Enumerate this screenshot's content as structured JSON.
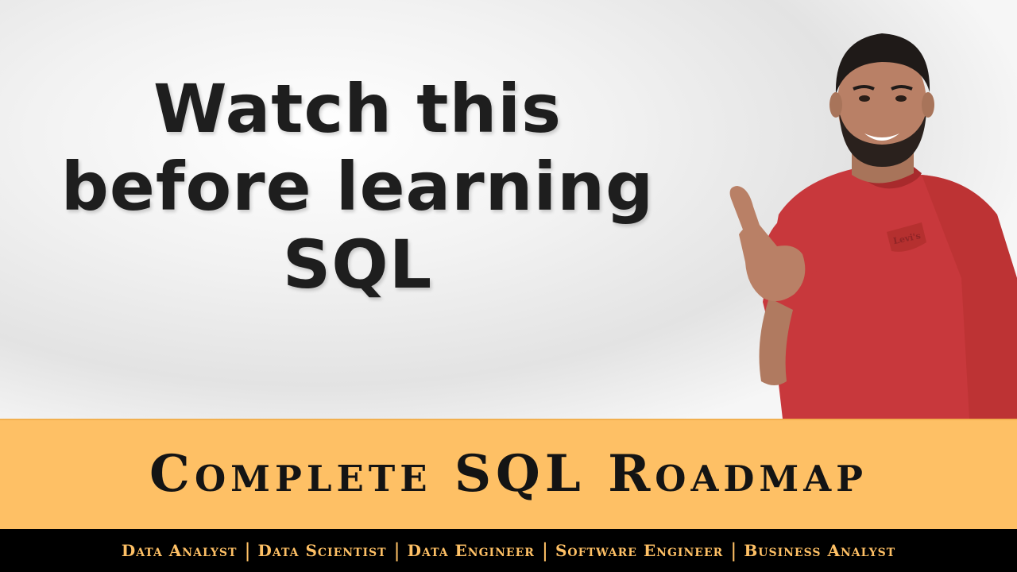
{
  "headline": {
    "line1": "Watch this",
    "line2": "before learning",
    "line3": "SQL"
  },
  "shirt_logo": "Levi's",
  "banner": {
    "title": "Complete SQL Roadmap"
  },
  "roles": [
    "Data Analyst",
    "Data Scientist",
    "Data Engineer",
    "Software Engineer",
    "Business Analyst"
  ],
  "separator": "|",
  "colors": {
    "banner_bg": "#fec065",
    "roles_bg": "#000000",
    "roles_text": "#fec065",
    "headline_text": "#1e1e1e",
    "shirt": "#c8383c"
  }
}
